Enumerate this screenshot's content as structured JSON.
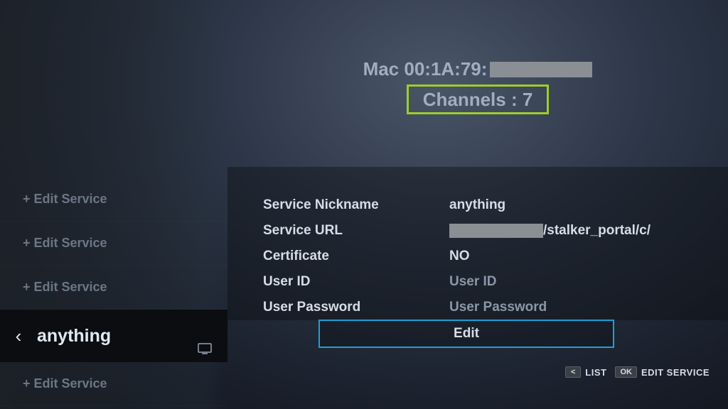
{
  "sidebar": {
    "items": [
      {
        "label": "+ Edit Service"
      },
      {
        "label": "+ Edit Service"
      },
      {
        "label": "+ Edit Service"
      }
    ],
    "selected_label": "anything",
    "post_item": {
      "label": "+ Edit Service"
    }
  },
  "top": {
    "mac_prefix": "Mac 00:1A:79:",
    "channels_label": "Channels : 7"
  },
  "details": {
    "rows": [
      {
        "label": "Service Nickname",
        "value": "anything",
        "placeholder": false
      },
      {
        "label": "Service URL",
        "value": "/stalker_portal/c/",
        "masked_prefix": true
      },
      {
        "label": "Certificate",
        "value": "NO",
        "placeholder": false
      },
      {
        "label": "User ID",
        "value": "User ID",
        "placeholder": true
      },
      {
        "label": "User Password",
        "value": "User Password",
        "placeholder": true
      }
    ]
  },
  "edit_button": "Edit",
  "footer": {
    "back_key": "<",
    "list_label": "LIST",
    "ok_key": "OK",
    "edit_service_label": "EDIT SERVICE"
  }
}
